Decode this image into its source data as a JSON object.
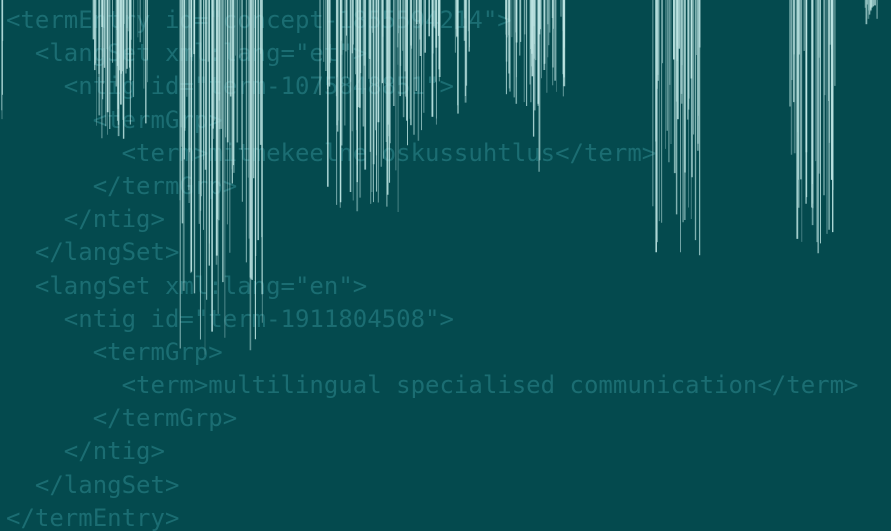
{
  "code_lines": [
    "<termEntry id=\"concept-1855594214\">",
    "  <langSet xml:lang=\"et\">",
    "    <ntig id=\"term-1075848851\">",
    "      <termGrp>",
    "        <term>mitmekeelne oskussuhtlus</term>",
    "      </termGrp>",
    "    </ntig>",
    "  </langSet>",
    "  <langSet xml:lang=\"en\">",
    "    <ntig id=\"term-1911804508\">",
    "      <termGrp>",
    "        <term>multilingual specialised communication</term>",
    "      </termGrp>",
    "    </ntig>",
    "  </langSet>",
    "</termEntry>"
  ],
  "colors": {
    "background": "#044a4e",
    "code_text": "#1b6d72",
    "streak": "#bfe6e4"
  }
}
